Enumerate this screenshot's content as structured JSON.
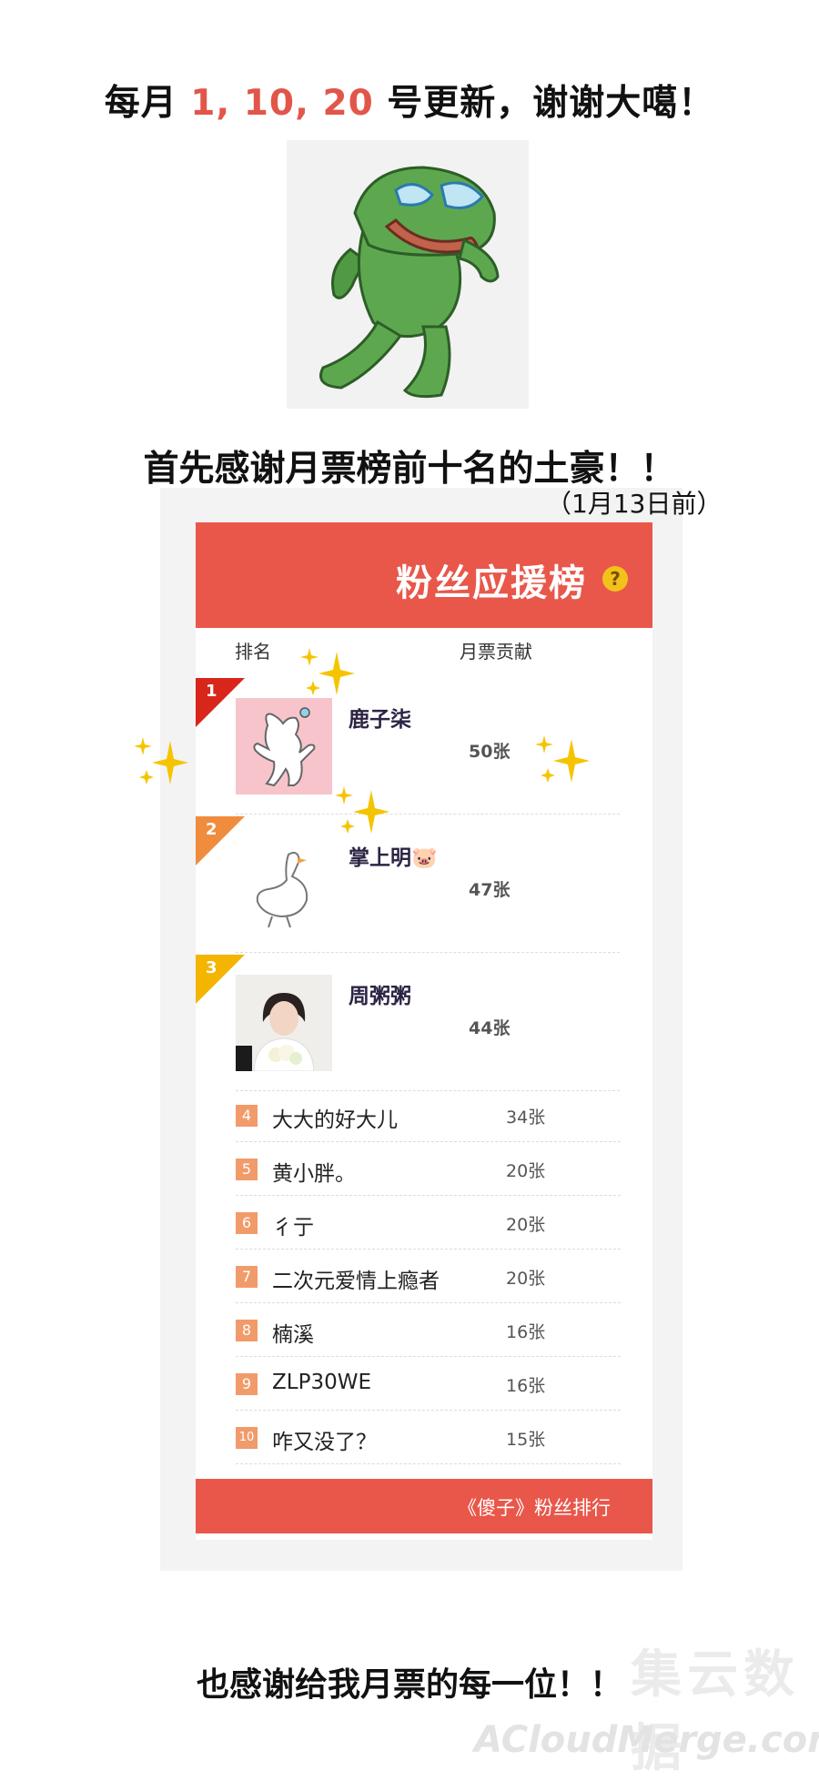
{
  "header": {
    "prefix": "每月 ",
    "dates": "1, 10, 20",
    "suffix": " 号更新，谢谢大噶！"
  },
  "intro": {
    "line": "首先感谢月票榜前十名的土豪！！",
    "date_note": "（1月13日前）"
  },
  "board": {
    "title": "粉丝应援榜",
    "help_symbol": "?",
    "col_rank": "排名",
    "col_votes": "月票贡献",
    "top_entries": [
      {
        "rank": "1",
        "name": "鹿子柒",
        "votes": "50张"
      },
      {
        "rank": "2",
        "name": "掌上明🐷",
        "votes": "47张"
      },
      {
        "rank": "3",
        "name": "周粥粥",
        "votes": "44张"
      }
    ],
    "entries": [
      {
        "rank": "4",
        "name": "大大的好大儿",
        "votes": "34张"
      },
      {
        "rank": "5",
        "name": "黄小胖。",
        "votes": "20张"
      },
      {
        "rank": "6",
        "name": "彳亍",
        "votes": "20张"
      },
      {
        "rank": "7",
        "name": "二次元爱情上瘾者",
        "votes": "20张"
      },
      {
        "rank": "8",
        "name": "楠溪",
        "votes": "16张"
      },
      {
        "rank": "9",
        "name": "ZLP30WE",
        "votes": "16张"
      },
      {
        "rank": "10",
        "name": "咋又没了？",
        "votes": "15张"
      }
    ],
    "footer": "《傻子》粉丝排行"
  },
  "closing": "也感谢给我月票的每一位！！",
  "watermark": {
    "big": "集云数据",
    "small": "ACloudMerge.com"
  },
  "colors": {
    "brand_red": "#e9574a",
    "rank1": "#d8261b",
    "rank2": "#f08c3d",
    "rank3": "#f4b400",
    "rank_box": "#f19b6b",
    "sparkle": "#f5c400"
  },
  "icons": {
    "frog": "crying-frog-sticker",
    "sparkle": "sparkle-icon",
    "help": "help-icon"
  }
}
